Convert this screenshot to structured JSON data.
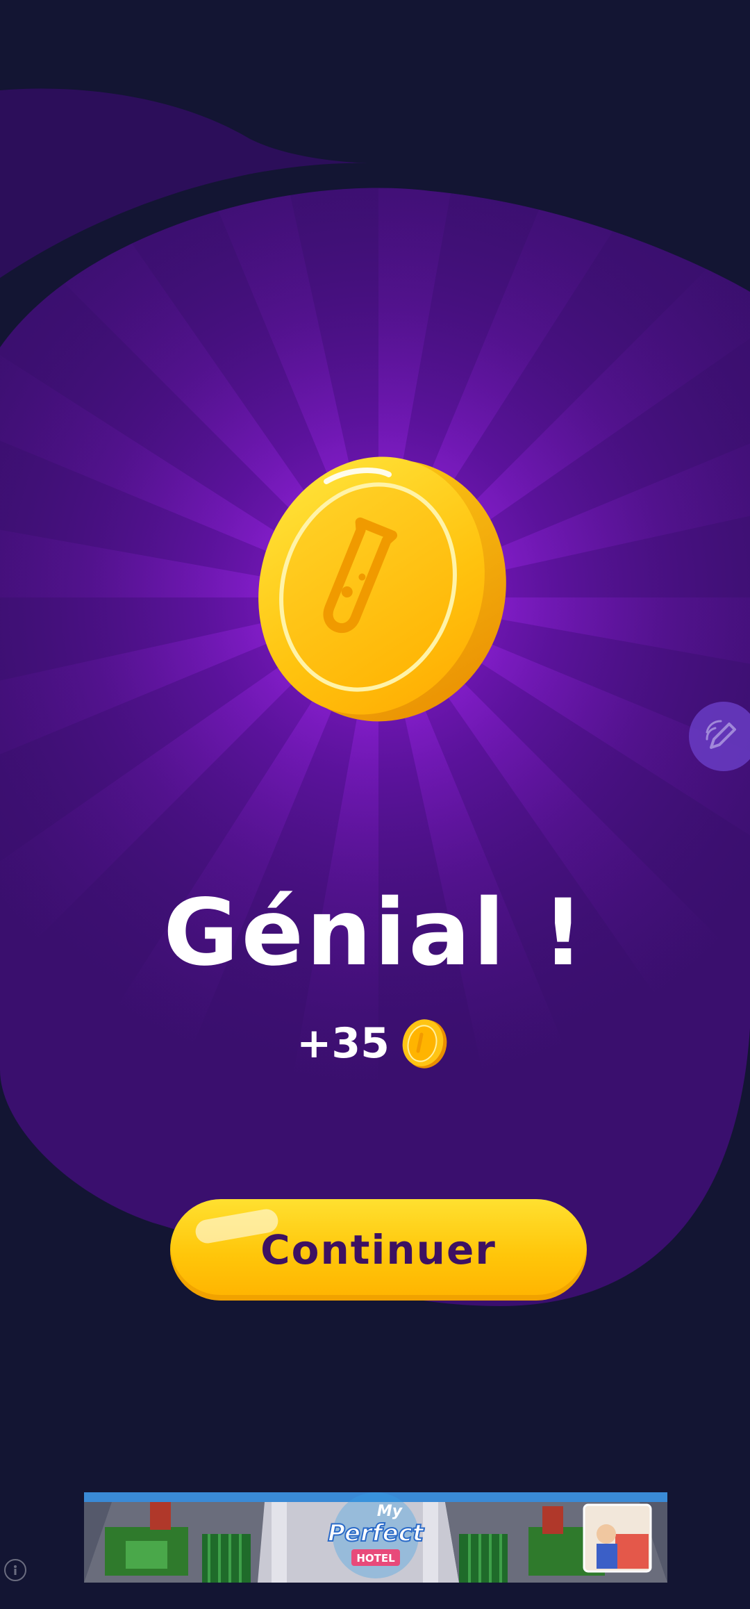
{
  "reward_screen": {
    "title": "Génial !",
    "reward_amount": "+35",
    "coin_icon": "coin-flask-icon",
    "continue_label": "Continuer"
  },
  "edit_fab": {
    "icon": "pencil-icon"
  },
  "ad_banner": {
    "logo_line1": "My",
    "logo_line2": "Perfect",
    "logo_line3": "HOTEL",
    "info_icon": "info-icon"
  },
  "colors": {
    "background": "#131533",
    "purple_blob": "#3a0f6e",
    "ray_glow": "#8a1bd0",
    "coin": "#ffc20e",
    "button": "#ffc60a",
    "button_text": "#3d1162",
    "title_text": "#ffffff"
  }
}
